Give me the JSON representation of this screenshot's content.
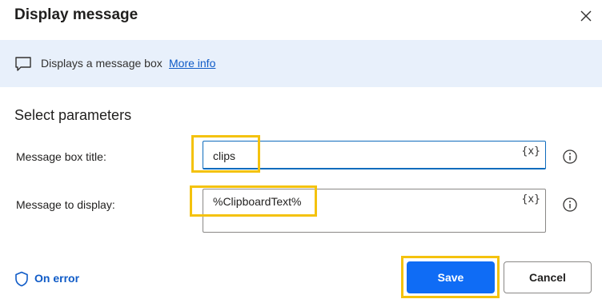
{
  "dialog": {
    "title": "Display message",
    "close_icon": "close-icon"
  },
  "info_bar": {
    "icon": "message-icon",
    "text": "Displays a message box",
    "link": "More info",
    "background": "#e8f0fb"
  },
  "parameters": {
    "section_title": "Select parameters",
    "fields": [
      {
        "label": "Message box title:",
        "value": "clips",
        "variable_button": "{x}"
      },
      {
        "label": "Message to display:",
        "value": "%ClipboardText%",
        "variable_button": "{x}"
      }
    ]
  },
  "footer": {
    "on_error_label": "On error",
    "save_label": "Save",
    "cancel_label": "Cancel"
  },
  "colors": {
    "accent": "#0f6cf5",
    "link": "#0f5bc7",
    "highlight": "#f4c20d"
  }
}
